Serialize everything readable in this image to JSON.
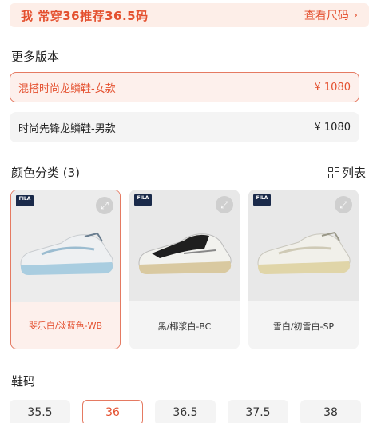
{
  "banner": {
    "recommendation": "我 常穿36推荐36.5码",
    "chart_link": "查看尺码",
    "chevron": "chevron-right-icon"
  },
  "versions": {
    "title": "更多版本",
    "items": [
      {
        "name": "混搭时尚龙鳞鞋-女款",
        "price": "¥ 1080",
        "selected": true
      },
      {
        "name": "时尚先锋龙鳞鞋-男款",
        "price": "¥ 1080",
        "selected": false
      }
    ]
  },
  "colors": {
    "title": "颜色分类 (3)",
    "view_toggle": "列表",
    "brand": "FILA",
    "items": [
      {
        "label": "斐乐白/淡蓝色-WB",
        "selected": true
      },
      {
        "label": "黑/椰浆白-BC",
        "selected": false
      },
      {
        "label": "雪白/初雪白-SP",
        "selected": false
      }
    ]
  },
  "sizes": {
    "title": "鞋码",
    "items": [
      "35.5",
      "36",
      "36.5",
      "37.5",
      "38"
    ],
    "selected": "36"
  },
  "theme": {
    "accent": "#e4502f",
    "accent_border": "#e57a62",
    "accent_bg": "#fdf0ec"
  }
}
